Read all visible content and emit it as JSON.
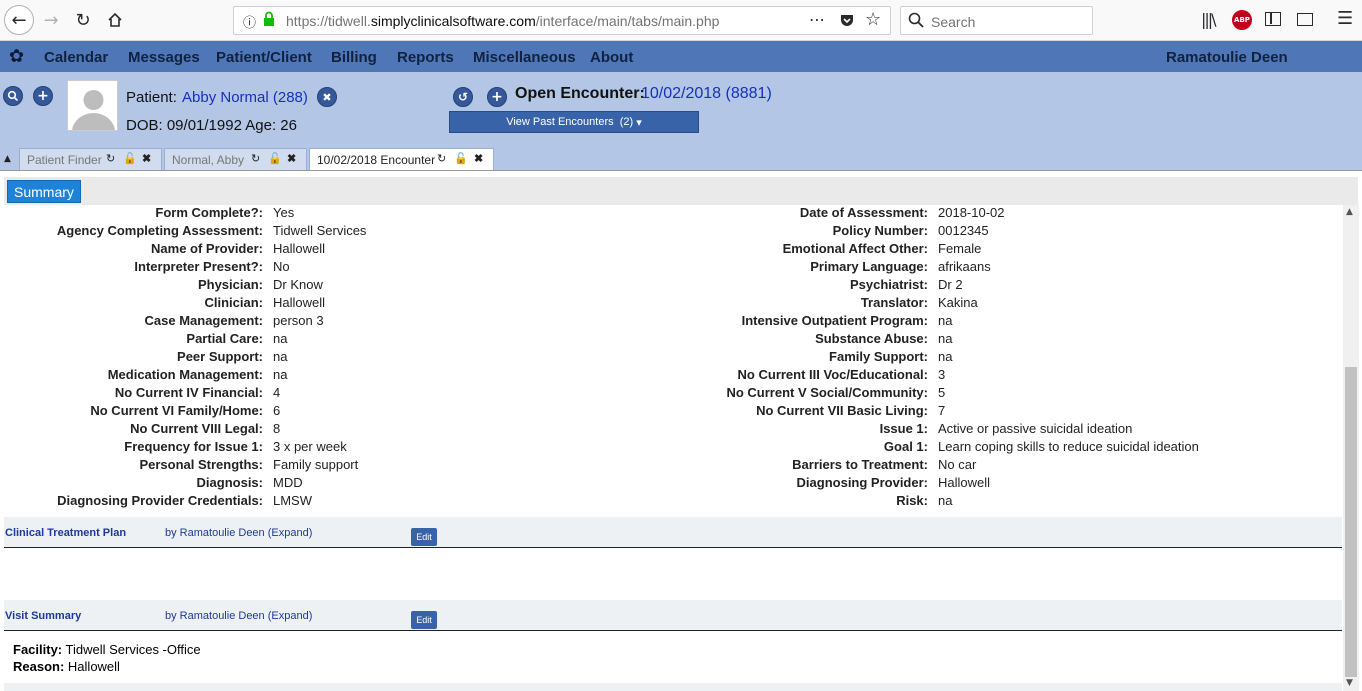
{
  "browser": {
    "url_prefix": "https://tidwell.",
    "url_host": "simplyclinicalsoftware.com",
    "url_path": "/interface/main/tabs/main.php",
    "search_placeholder": "Search",
    "abp_label": "ABP"
  },
  "menu": {
    "items": [
      "Calendar",
      "Messages",
      "Patient/Client",
      "Billing",
      "Reports",
      "Miscellaneous",
      "About"
    ],
    "user": "Ramatoulie Deen"
  },
  "patient": {
    "label": "Patient:",
    "name": "Abby Normal (288)",
    "dob_line": "DOB: 09/01/1992 Age: 26",
    "encounter_label": "Open Encounter:",
    "encounter_value": "10/02/2018 (8881)",
    "past_encounters_label": "View Past Encounters",
    "past_encounters_count": "(2)"
  },
  "tabs": [
    {
      "label": "Patient Finder",
      "active": false
    },
    {
      "label": "Normal, Abby",
      "active": false
    },
    {
      "label": "10/02/2018 Encounter",
      "active": true
    }
  ],
  "summary_tab": "Summary",
  "fields_left": [
    {
      "label": "Form Complete?:",
      "value": "Yes"
    },
    {
      "label": "Agency Completing Assessment:",
      "value": "Tidwell Services"
    },
    {
      "label": "Name of Provider:",
      "value": "Hallowell"
    },
    {
      "label": "Interpreter Present?:",
      "value": "No"
    },
    {
      "label": "Physician:",
      "value": "Dr Know"
    },
    {
      "label": "Clinician:",
      "value": "Hallowell"
    },
    {
      "label": "Case Management:",
      "value": "person 3"
    },
    {
      "label": "Partial Care:",
      "value": "na"
    },
    {
      "label": "Peer Support:",
      "value": "na"
    },
    {
      "label": "Medication Management:",
      "value": "na"
    },
    {
      "label": "No Current IV Financial:",
      "value": "4"
    },
    {
      "label": "No Current VI Family/Home:",
      "value": "6"
    },
    {
      "label": "No Current VIII Legal:",
      "value": "8"
    },
    {
      "label": "Frequency for Issue 1:",
      "value": "3 x per week"
    },
    {
      "label": "Personal Strengths:",
      "value": "Family support"
    },
    {
      "label": "Diagnosis:",
      "value": "MDD"
    },
    {
      "label": "Diagnosing Provider Credentials:",
      "value": "LMSW"
    }
  ],
  "fields_right": [
    {
      "label": "Date of Assessment:",
      "value": "2018-10-02"
    },
    {
      "label": "Policy Number:",
      "value": "0012345"
    },
    {
      "label": "Emotional Affect Other:",
      "value": "Female"
    },
    {
      "label": "Primary Language:",
      "value": "afrikaans"
    },
    {
      "label": "Psychiatrist:",
      "value": "Dr 2"
    },
    {
      "label": "Translator:",
      "value": "Kakina"
    },
    {
      "label": "Intensive Outpatient Program:",
      "value": "na"
    },
    {
      "label": "Substance Abuse:",
      "value": "na"
    },
    {
      "label": "Family Support:",
      "value": "na"
    },
    {
      "label": "No Current III Voc/Educational:",
      "value": "3"
    },
    {
      "label": "No Current V Social/Community:",
      "value": "5"
    },
    {
      "label": "No Current VII Basic Living:",
      "value": "7"
    },
    {
      "label": "Issue 1:",
      "value": "Active or passive suicidal ideation"
    },
    {
      "label": "Goal 1:",
      "value": "Learn coping skills to reduce suicidal ideation"
    },
    {
      "label": "Barriers to Treatment:",
      "value": "No car"
    },
    {
      "label": "Diagnosing Provider:",
      "value": "Hallowell"
    },
    {
      "label": "Risk:",
      "value": "na"
    }
  ],
  "sections": {
    "treatment_plan": {
      "title": "Clinical Treatment Plan",
      "by": "by Ramatoulie Deen (Expand)",
      "edit": "Edit"
    },
    "visit_summary": {
      "title": "Visit Summary",
      "by": "by Ramatoulie Deen (Expand)",
      "edit": "Edit"
    }
  },
  "visit": {
    "facility_label": "Facility:",
    "facility_value": "Tidwell Services -Office",
    "reason_label": "Reason:",
    "reason_value": "Hallowell"
  }
}
